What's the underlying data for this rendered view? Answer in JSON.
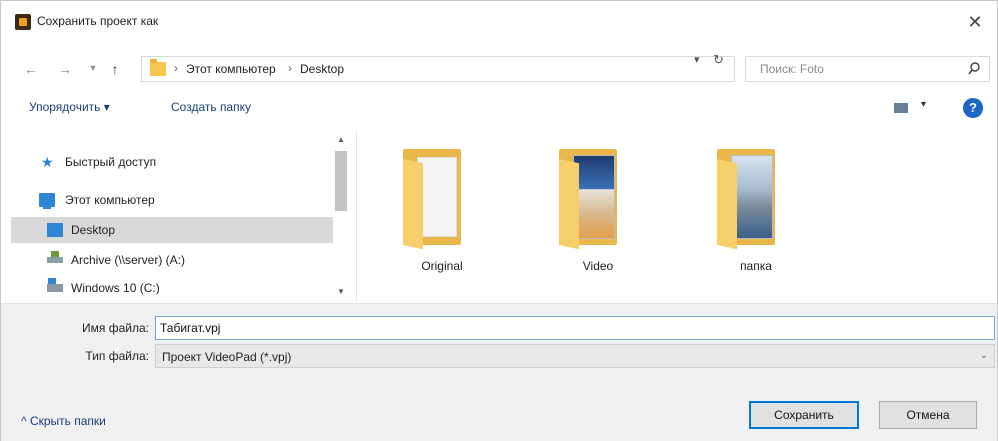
{
  "window": {
    "title": "Сохранить проект как",
    "close": "✕"
  },
  "address": {
    "back": "←",
    "forward": "→",
    "recent": "▾",
    "up": "↑",
    "crumbs": [
      "Этот компьютер",
      "Desktop"
    ],
    "sep": "›",
    "dropdown": "▾",
    "refresh": "↻",
    "search_placeholder": "Поиск: Foto"
  },
  "toolbar": {
    "organize": "Упорядочить ▾",
    "new_folder": "Создать папку",
    "view_dd": "▾",
    "help": "?"
  },
  "nav": {
    "items": [
      {
        "label": "Быстрый доступ",
        "icon": "star-icon"
      },
      {
        "label": "Этот компьютер",
        "icon": "computer-icon"
      },
      {
        "label": "Desktop",
        "icon": "desktop-icon",
        "selected": true
      },
      {
        "label": "Archive (\\\\server) (A:)",
        "icon": "network-drive-icon"
      },
      {
        "label": "Windows 10 (C:)",
        "icon": "drive-icon"
      }
    ],
    "scroll_up": "▲",
    "scroll_down": "▼"
  },
  "files": [
    {
      "name": "Original",
      "thumb": "documents"
    },
    {
      "name": "Video",
      "thumb": "video"
    },
    {
      "name": "папка",
      "thumb": "city"
    }
  ],
  "form": {
    "filename_label": "Имя файла:",
    "filename_value": "Табигат.vpj",
    "filetype_label": "Тип файла:",
    "filetype_value": "Проект VideoPad (*.vpj)",
    "dd": "⌄"
  },
  "footer": {
    "hide_folders": "^  Скрыть папки",
    "save": "Сохранить",
    "cancel": "Отмена"
  },
  "colors": {
    "accent": "#0078d7",
    "folder": "#eab84a",
    "selected_bg": "#d9d9d9"
  }
}
